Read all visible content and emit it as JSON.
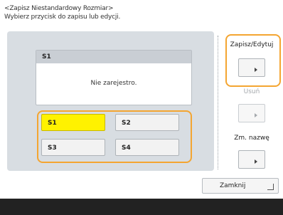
{
  "header": {
    "line1": "<Zapisz Niestandardowy Rozmiar>",
    "line2": "Wybierz przycisk do zapisu lub edycji."
  },
  "preview": {
    "title": "S1",
    "message": "Nie zarejestro."
  },
  "slots": [
    "S1",
    "S2",
    "S3",
    "S4"
  ],
  "selected_slot": "S1",
  "side": {
    "save_edit_label": "Zapisz/Edytuj",
    "delete_label": "Usuń",
    "rename_label": "Zm. nazwę"
  },
  "close_label": "Zamknij",
  "colors": {
    "highlight_outline": "#f4a531",
    "selected_slot_bg": "#fff200"
  }
}
